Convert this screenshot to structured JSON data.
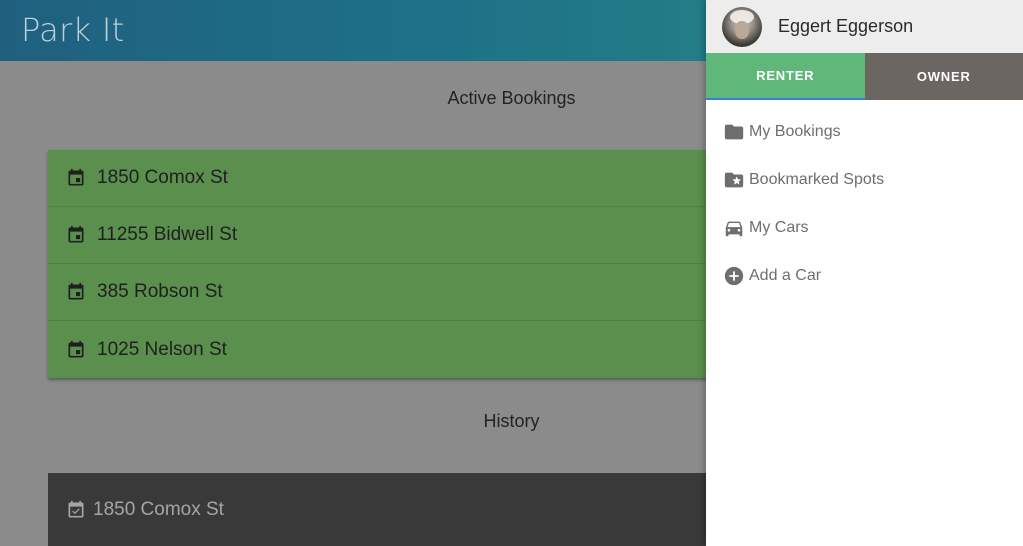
{
  "app": {
    "title": "Park It"
  },
  "main": {
    "active_title": "Active Bookings",
    "active_bookings": [
      {
        "address": "1850 Comox St"
      },
      {
        "address": "11255 Bidwell St"
      },
      {
        "address": "385 Robson St"
      },
      {
        "address": "1025 Nelson St"
      }
    ],
    "history_title": "History",
    "history": [
      {
        "address": "1850 Comox St"
      }
    ]
  },
  "drawer": {
    "user_name": "Eggert Eggerson",
    "tabs": [
      {
        "label": "RENTER",
        "active": true
      },
      {
        "label": "OWNER",
        "active": false
      }
    ],
    "menu": [
      {
        "label": "My Bookings",
        "icon": "folder-icon"
      },
      {
        "label": "Bookmarked Spots",
        "icon": "folder-star-icon"
      },
      {
        "label": "My Cars",
        "icon": "car-icon"
      },
      {
        "label": "Add a Car",
        "icon": "add-circle-icon"
      }
    ]
  },
  "colors": {
    "appbar": "#1e7287",
    "booking_bg": "#5b8f4d",
    "history_bg": "#393939",
    "tab_active": "#5fb87a",
    "tab_inactive": "#6c6663"
  }
}
